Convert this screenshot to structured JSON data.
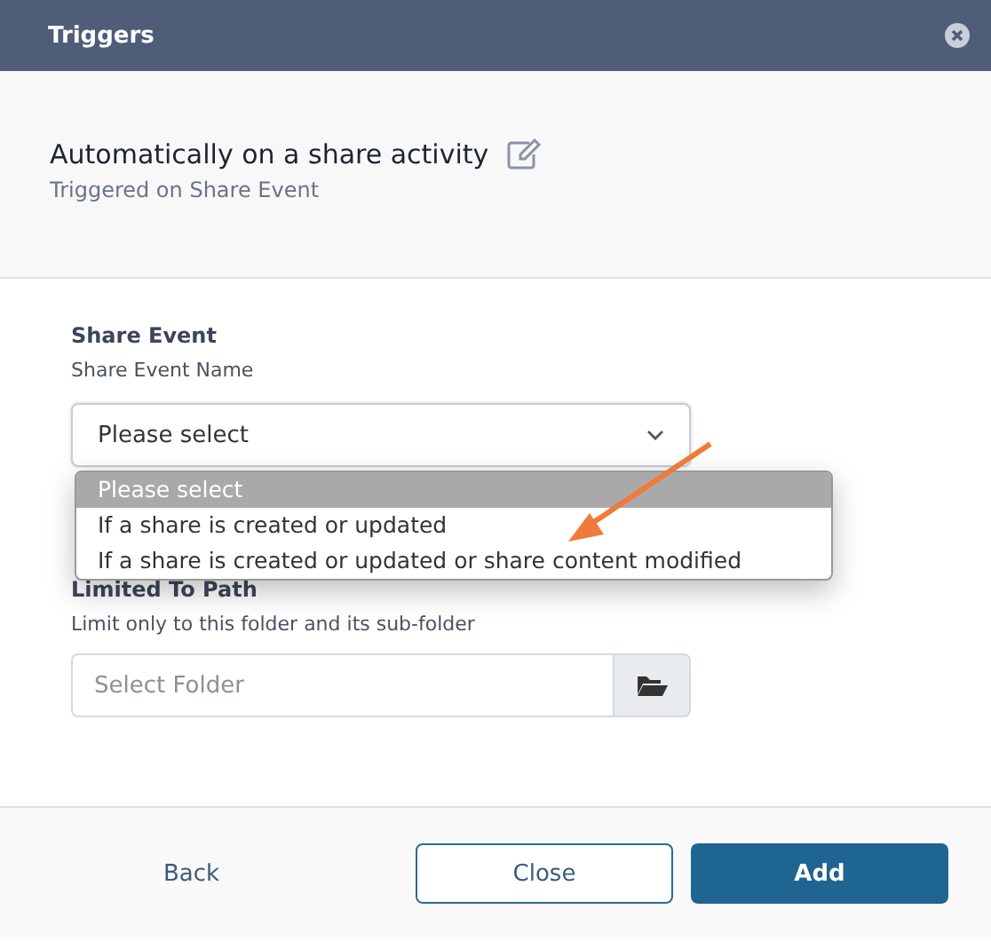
{
  "window": {
    "title": "Triggers"
  },
  "trigger": {
    "title": "Automatically on a share activity",
    "subtitle": "Triggered on Share Event"
  },
  "share_event": {
    "label": "Share Event",
    "hint": "Share Event Name",
    "value": "Please select",
    "expanded": true,
    "options": [
      {
        "label": "Please select",
        "selected": true
      },
      {
        "label": "If a share is created or updated",
        "selected": false
      },
      {
        "label": "If a share is created or updated or share content modified",
        "selected": false
      }
    ]
  },
  "path": {
    "label": "Limited To Path",
    "hint": "Limit only to this folder and its sub-folder",
    "placeholder": "Select Folder"
  },
  "buttons": [
    {
      "label": "Back",
      "kind": "link"
    },
    {
      "label": "Close",
      "kind": "outline"
    },
    {
      "label": "Add",
      "kind": "primary"
    }
  ]
}
